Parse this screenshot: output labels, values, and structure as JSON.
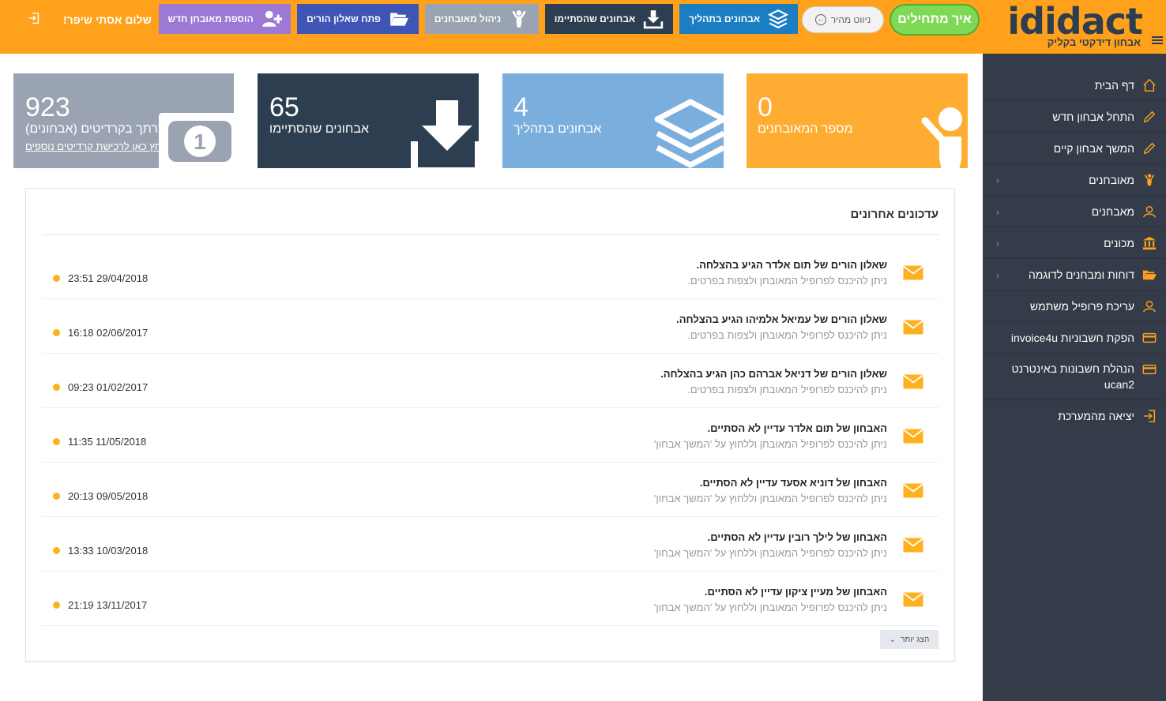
{
  "header": {
    "logo_text": "ididact",
    "logo_subtitle": "אבחון דידקטי בקליק",
    "start_button": "איך מתחילים",
    "nav_button": "ניווט מהיר",
    "buttons": [
      {
        "label": "אבחונים בתהליך"
      },
      {
        "label": "אבחונים שהסתיימו"
      },
      {
        "label": "ניהול מאובחנים"
      },
      {
        "label": "פתח שאלון הורים"
      },
      {
        "label": "הוספת מאובחן חדש"
      }
    ],
    "greeting": "שלום אסתי שיפר!"
  },
  "sidebar": {
    "items": [
      {
        "label": "דף הבית",
        "icon": "home-icon"
      },
      {
        "label": "התחל אבחון חדש",
        "icon": "pencil-icon"
      },
      {
        "label": "המשך אבחון קיים",
        "icon": "pencil-icon"
      },
      {
        "label": "מאובחנים",
        "icon": "child-icon",
        "chevron": "‹"
      },
      {
        "label": "מאבחנים",
        "icon": "user-icon",
        "chevron": "‹"
      },
      {
        "label": "מכונים",
        "icon": "institution-icon",
        "chevron": "‹"
      },
      {
        "label": "דוחות ומבחנים לדוגמה",
        "icon": "folder-icon",
        "chevron": "‹"
      },
      {
        "label": "עריכת פרופיל משתמש",
        "icon": "user-icon"
      },
      {
        "label": "הפקת חשבוניות invoice4u",
        "icon": "card-icon"
      },
      {
        "label": "הנהלת חשבונות באינטרנט ucan2",
        "icon": "card-icon"
      },
      {
        "label": "יציאה מהמערכת",
        "icon": "logout-icon"
      }
    ]
  },
  "stats": [
    {
      "value": "0",
      "label": "מספר המאובחנים",
      "icon": "child-icon",
      "color": "#ffac33"
    },
    {
      "value": "4",
      "label": "אבחונים בתהליך",
      "icon": "layers-icon",
      "color": "#7aaedc"
    },
    {
      "value": "65",
      "label": "אבחונים שהסתיימו",
      "icon": "download-icon",
      "color": "#2d3e50"
    },
    {
      "value": "923",
      "label": "תרתך בקרדיטים (אבחונים)",
      "link": "לחץ כאן לרכישת קרדיטים נוספים",
      "icon": "banknote-icon",
      "color": "#9aa3b2"
    }
  ],
  "updates": {
    "title": "עדכונים אחרונים",
    "items": [
      {
        "title": "שאלון הורים של תום אלדר הגיע בהצלחה.",
        "subtitle": "ניתן להיכנס לפרופיל המאובחן ולצפות בפרטים.",
        "time": "23:51 29/04/2018"
      },
      {
        "title": "שאלון הורים של עמיאל אלמיהו הגיע בהצלחה.",
        "subtitle": "ניתן להיכנס לפרופיל המאובחן ולצפות בפרטים.",
        "time": "16:18 02/06/2017"
      },
      {
        "title": "שאלון הורים של דניאל אברהם כהן הגיע בהצלחה.",
        "subtitle": "ניתן להיכנס לפרופיל המאובחן ולצפות בפרטים.",
        "time": "09:23 01/02/2017"
      },
      {
        "title": "האבחון של תום אלדר עדיין לא הסתיים.",
        "subtitle": "ניתן להיכנס לפרופיל המאובחן וללחוץ על 'המשך אבחון'",
        "time": "11:35 11/05/2018"
      },
      {
        "title": "האבחון של דוניא אסעד עדיין לא הסתיים.",
        "subtitle": "ניתן להיכנס לפרופיל המאובחן וללחוץ על 'המשך אבחון'",
        "time": "20:13 09/05/2018"
      },
      {
        "title": "האבחון של לילך רובין עדיין לא הסתיים.",
        "subtitle": "ניתן להיכנס לפרופיל המאובחן וללחוץ על 'המשך אבחון'",
        "time": "13:33 10/03/2018"
      },
      {
        "title": "האבחון של מעיין ציקון עדיין לא הסתיים.",
        "subtitle": "ניתן להיכנס לפרופיל המאובחן וללחוץ על 'המשך אבחון'",
        "time": "21:19 13/11/2017"
      }
    ],
    "more_button": "הצג יותר"
  },
  "colors": {
    "topbar": "#ffa11a",
    "sidebar": "#333c48",
    "accent": "#ffb020"
  }
}
